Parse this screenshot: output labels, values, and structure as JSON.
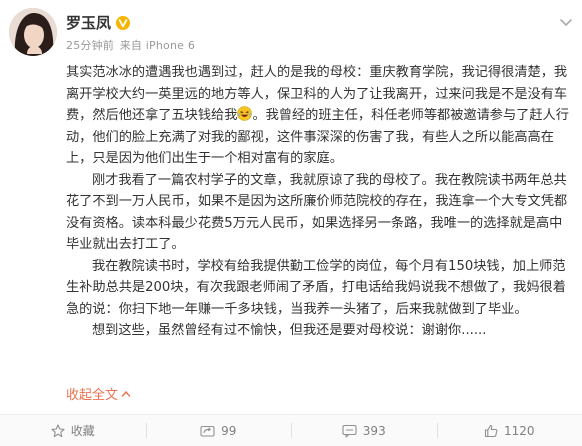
{
  "post": {
    "author": "罗玉凤",
    "time": "25分钟前",
    "source": "来自 iPhone 6",
    "paragraphs": [
      "其实范冰冰的遭遇我也遇到过，赶人的是我的母校：重庆教育学院，我记得很清楚，我离开学校大约一英里远的地方等人，保卫科的人为了让我离开，过来问我是不是没有车费，然后他还拿了五块钱给我",
      "。我曾经的班主任，科任老师等都被邀请参与了赶人行动，他们的脸上充满了对我的鄙视，这件事深深的伤害了我，有些人之所以能高高在上，只是因为他们出生于一个相对富有的家庭。",
      "刚才我看了一篇农村学子的文章，我就原谅了我的母校了。我在教院读书两年总共花了不到一万人民币，如果不是因为这所廉价师范院校的存在，我连拿一个大专文凭都没有资格。读本科最少花费5万元人民币，如果选择另一条路，我唯一的选择就是高中毕业就出去打工了。",
      "我在教院读书时，学校有给我提供勤工俭学的岗位，每个月有150块钱，加上师范生补助总共是200块，有次我跟老师闹了矛盾，打电话给我妈说我不想做了，我妈很着急的说：你扫下地一年赚一千多块钱，当我养一头猪了，后来我就做到了毕业。",
      "想到这些，虽然曾经有过不愉快，但我还是要对母校说：谢谢你......"
    ],
    "collapse_label": "收起全文"
  },
  "toolbar": {
    "favorite_label": "收藏",
    "repost_count": "99",
    "comment_count": "393",
    "like_count": "1120"
  },
  "icons": {
    "verified": "verified-v-badge",
    "more": "chevron-down-icon",
    "emoji": "laughing-emoji",
    "favorite": "star-icon",
    "repost": "repost-icon",
    "comment": "comment-icon",
    "like": "thumbs-up-icon"
  },
  "colors": {
    "verified": "#f8b500",
    "collapse_link": "#eb7350",
    "muted_text": "#999999",
    "toolbar_text": "#808080"
  }
}
